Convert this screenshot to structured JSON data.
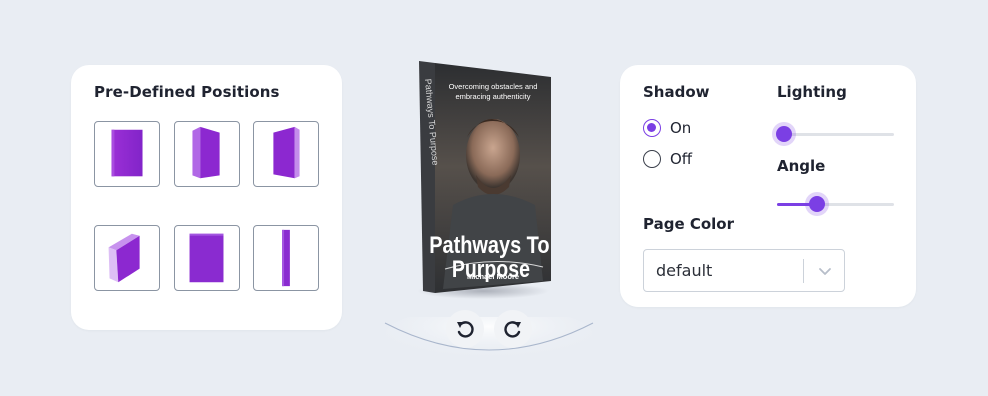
{
  "positions_panel": {
    "title": "Pre-Defined Positions",
    "tiles": [
      {
        "name": "front"
      },
      {
        "name": "angled-right"
      },
      {
        "name": "angled-left"
      },
      {
        "name": "lying-down"
      },
      {
        "name": "front-flat"
      },
      {
        "name": "spine"
      }
    ],
    "accent": "#8a2be2"
  },
  "book": {
    "tagline_line1": "Overcoming obstacles and",
    "tagline_line2": "embracing authenticity",
    "title_line1": "Pathways To",
    "title_line2": "Purpose",
    "author": "Michael Moore",
    "spine_text": "Pathways To Purpose"
  },
  "controls": {
    "rotate_left_icon": "rotate-left-icon",
    "rotate_right_icon": "rotate-right-icon"
  },
  "settings": {
    "shadow_label": "Shadow",
    "shadow_options": [
      {
        "label": "On",
        "checked": true
      },
      {
        "label": "Off",
        "checked": false
      }
    ],
    "lighting_label": "Lighting",
    "lighting_value": 0.06,
    "angle_label": "Angle",
    "angle_value": 0.34,
    "page_color_label": "Page Color",
    "page_color_value": "default",
    "accent": "#7b3fe4"
  }
}
